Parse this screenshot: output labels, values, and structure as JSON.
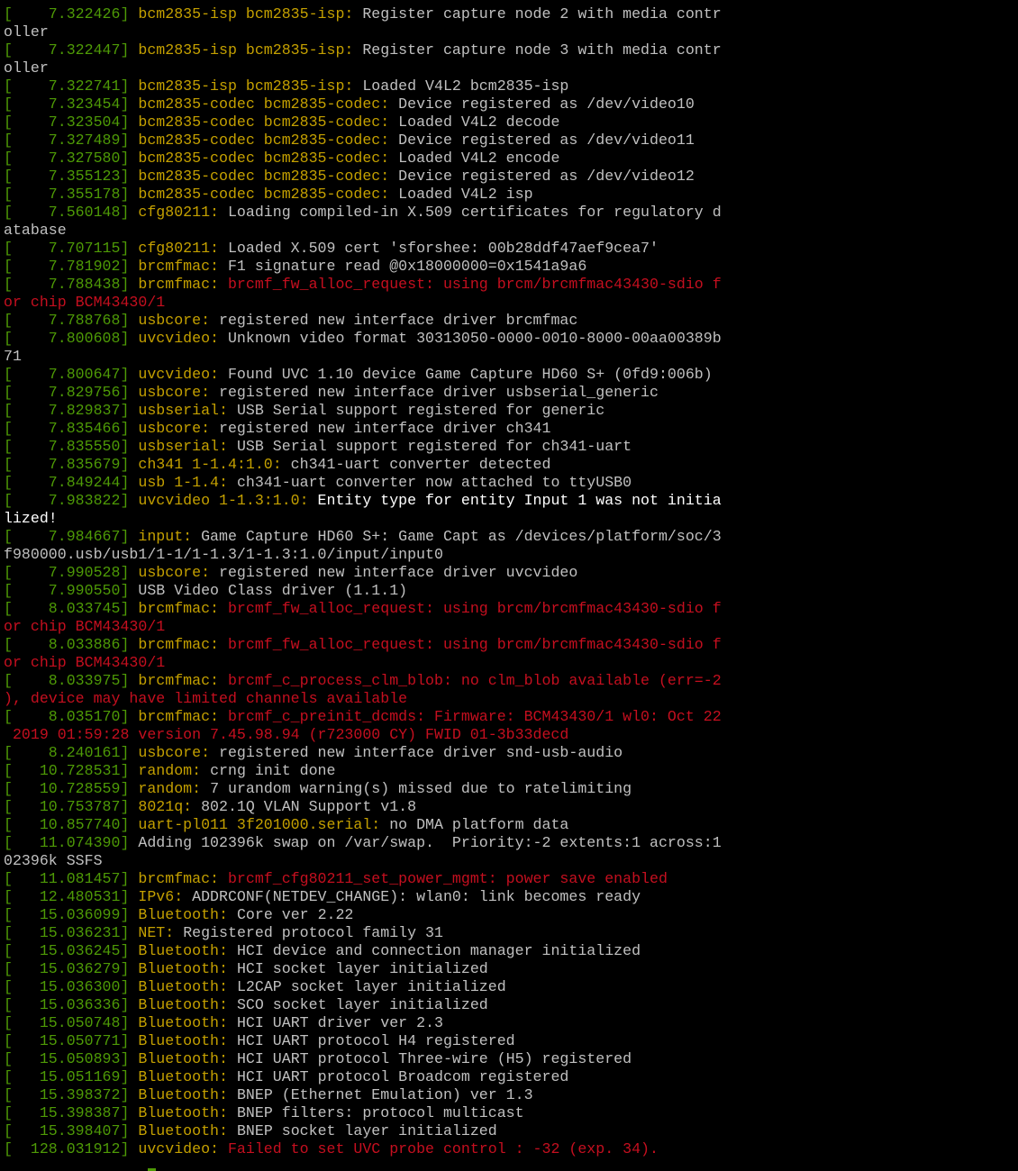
{
  "terminal": {
    "colors": {
      "background": "#000000",
      "text": "#c0c0c0",
      "bracket_timestamp": "#4e9a06",
      "module": "#c4a000",
      "error": "#c50f1f",
      "bold": "#ffffff"
    },
    "lines": [
      {
        "text": "oller",
        "style": "plain"
      },
      {
        "ts": "[    7.322426]",
        "mod": "bcm2835-isp bcm2835-isp:",
        "msg": " Register capture node 2 with media contr",
        "style": "normal"
      },
      {
        "text": "oller",
        "style": "plain"
      },
      {
        "ts": "[    7.322447]",
        "mod": "bcm2835-isp bcm2835-isp:",
        "msg": " Register capture node 3 with media contr",
        "style": "normal"
      },
      {
        "text": "oller",
        "style": "plain"
      },
      {
        "ts": "[    7.322741]",
        "mod": "bcm2835-isp bcm2835-isp:",
        "msg": " Loaded V4L2 bcm2835-isp",
        "style": "normal"
      },
      {
        "ts": "[    7.323454]",
        "mod": "bcm2835-codec bcm2835-codec:",
        "msg": " Device registered as /dev/video10",
        "style": "normal"
      },
      {
        "ts": "[    7.323504]",
        "mod": "bcm2835-codec bcm2835-codec:",
        "msg": " Loaded V4L2 decode",
        "style": "normal"
      },
      {
        "ts": "[    7.327489]",
        "mod": "bcm2835-codec bcm2835-codec:",
        "msg": " Device registered as /dev/video11",
        "style": "normal"
      },
      {
        "ts": "[    7.327580]",
        "mod": "bcm2835-codec bcm2835-codec:",
        "msg": " Loaded V4L2 encode",
        "style": "normal"
      },
      {
        "ts": "[    7.355123]",
        "mod": "bcm2835-codec bcm2835-codec:",
        "msg": " Device registered as /dev/video12",
        "style": "normal"
      },
      {
        "ts": "[    7.355178]",
        "mod": "bcm2835-codec bcm2835-codec:",
        "msg": " Loaded V4L2 isp",
        "style": "normal"
      },
      {
        "ts": "[    7.560148]",
        "mod": "cfg80211:",
        "msg": " Loading compiled-in X.509 certificates for regulatory d",
        "style": "normal"
      },
      {
        "text": "atabase",
        "style": "plain"
      },
      {
        "ts": "[    7.707115]",
        "mod": "cfg80211:",
        "msg": " Loaded X.509 cert 'sforshee: 00b28ddf47aef9cea7'",
        "style": "normal"
      },
      {
        "ts": "[    7.781902]",
        "mod": "brcmfmac:",
        "msg": " F1 signature read @0x18000000=0x1541a9a6",
        "style": "normal"
      },
      {
        "ts": "[    7.788438]",
        "mod": "brcmfmac:",
        "msg": " brcmf_fw_alloc_request: using brcm/brcmfmac43430-sdio f",
        "style": "error"
      },
      {
        "text": "or chip BCM43430/1",
        "style": "plain-error"
      },
      {
        "ts": "[    7.788768]",
        "mod": "usbcore:",
        "msg": " registered new interface driver brcmfmac",
        "style": "normal"
      },
      {
        "ts": "[    7.800608]",
        "mod": "uvcvideo:",
        "msg": " Unknown video format 30313050-0000-0010-8000-00aa00389b",
        "style": "normal"
      },
      {
        "text": "71",
        "style": "plain"
      },
      {
        "ts": "[    7.800647]",
        "mod": "uvcvideo:",
        "msg": " Found UVC 1.10 device Game Capture HD60 S+ (0fd9:006b)",
        "style": "normal"
      },
      {
        "ts": "[    7.829756]",
        "mod": "usbcore:",
        "msg": " registered new interface driver usbserial_generic",
        "style": "normal"
      },
      {
        "ts": "[    7.829837]",
        "mod": "usbserial:",
        "msg": " USB Serial support registered for generic",
        "style": "normal"
      },
      {
        "ts": "[    7.835466]",
        "mod": "usbcore:",
        "msg": " registered new interface driver ch341",
        "style": "normal"
      },
      {
        "ts": "[    7.835550]",
        "mod": "usbserial:",
        "msg": " USB Serial support registered for ch341-uart",
        "style": "normal"
      },
      {
        "ts": "[    7.835679]",
        "mod": "ch341 1-1.4:1.0:",
        "msg": " ch341-uart converter detected",
        "style": "normal"
      },
      {
        "ts": "[    7.849244]",
        "mod": "usb 1-1.4:",
        "msg": " ch341-uart converter now attached to ttyUSB0",
        "style": "normal"
      },
      {
        "ts": "[    7.983822]",
        "mod": "uvcvideo 1-1.3:1.0:",
        "msg": " Entity type for entity Input 1 was not initia",
        "style": "bold"
      },
      {
        "text": "lized!",
        "style": "plain-bold"
      },
      {
        "ts": "[    7.984667]",
        "mod": "input:",
        "msg": " Game Capture HD60 S+: Game Capt as /devices/platform/soc/3",
        "style": "normal"
      },
      {
        "text": "f980000.usb/usb1/1-1/1-1.3/1-1.3:1.0/input/input0",
        "style": "plain"
      },
      {
        "ts": "[    7.990528]",
        "mod": "usbcore:",
        "msg": " registered new interface driver uvcvideo",
        "style": "normal"
      },
      {
        "ts": "[    7.990550]",
        "mod": "",
        "msg": "USB Video Class driver (1.1.1)",
        "style": "normal"
      },
      {
        "ts": "[    8.033745]",
        "mod": "brcmfmac:",
        "msg": " brcmf_fw_alloc_request: using brcm/brcmfmac43430-sdio f",
        "style": "error"
      },
      {
        "text": "or chip BCM43430/1",
        "style": "plain-error"
      },
      {
        "ts": "[    8.033886]",
        "mod": "brcmfmac:",
        "msg": " brcmf_fw_alloc_request: using brcm/brcmfmac43430-sdio f",
        "style": "error"
      },
      {
        "text": "or chip BCM43430/1",
        "style": "plain-error"
      },
      {
        "ts": "[    8.033975]",
        "mod": "brcmfmac:",
        "msg": " brcmf_c_process_clm_blob: no clm_blob available (err=-2",
        "style": "error"
      },
      {
        "text": "), device may have limited channels available",
        "style": "plain-error"
      },
      {
        "ts": "[    8.035170]",
        "mod": "brcmfmac:",
        "msg": " brcmf_c_preinit_dcmds: Firmware: BCM43430/1 wl0: Oct 22",
        "style": "error"
      },
      {
        "text": " 2019 01:59:28 version 7.45.98.94 (r723000 CY) FWID 01-3b33decd",
        "style": "plain-error"
      },
      {
        "ts": "[    8.240161]",
        "mod": "usbcore:",
        "msg": " registered new interface driver snd-usb-audio",
        "style": "normal"
      },
      {
        "ts": "[   10.728531]",
        "mod": "random:",
        "msg": " crng init done",
        "style": "normal"
      },
      {
        "ts": "[   10.728559]",
        "mod": "random:",
        "msg": " 7 urandom warning(s) missed due to ratelimiting",
        "style": "normal"
      },
      {
        "ts": "[   10.753787]",
        "mod": "8021q:",
        "msg": " 802.1Q VLAN Support v1.8",
        "style": "normal"
      },
      {
        "ts": "[   10.857740]",
        "mod": "uart-pl011 3f201000.serial:",
        "msg": " no DMA platform data",
        "style": "normal"
      },
      {
        "ts": "[   11.074390]",
        "mod": "",
        "msg": "Adding 102396k swap on /var/swap.  Priority:-2 extents:1 across:1",
        "style": "normal"
      },
      {
        "text": "02396k SSFS",
        "style": "plain"
      },
      {
        "ts": "[   11.081457]",
        "mod": "brcmfmac:",
        "msg": " brcmf_cfg80211_set_power_mgmt: power save enabled",
        "style": "error"
      },
      {
        "ts": "[   12.480531]",
        "mod": "IPv6:",
        "msg": " ADDRCONF(NETDEV_CHANGE): wlan0: link becomes ready",
        "style": "normal"
      },
      {
        "ts": "[   15.036099]",
        "mod": "Bluetooth:",
        "msg": " Core ver 2.22",
        "style": "normal"
      },
      {
        "ts": "[   15.036231]",
        "mod": "NET:",
        "msg": " Registered protocol family 31",
        "style": "normal"
      },
      {
        "ts": "[   15.036245]",
        "mod": "Bluetooth:",
        "msg": " HCI device and connection manager initialized",
        "style": "normal"
      },
      {
        "ts": "[   15.036279]",
        "mod": "Bluetooth:",
        "msg": " HCI socket layer initialized",
        "style": "normal"
      },
      {
        "ts": "[   15.036300]",
        "mod": "Bluetooth:",
        "msg": " L2CAP socket layer initialized",
        "style": "normal"
      },
      {
        "ts": "[   15.036336]",
        "mod": "Bluetooth:",
        "msg": " SCO socket layer initialized",
        "style": "normal"
      },
      {
        "ts": "[   15.050748]",
        "mod": "Bluetooth:",
        "msg": " HCI UART driver ver 2.3",
        "style": "normal"
      },
      {
        "ts": "[   15.050771]",
        "mod": "Bluetooth:",
        "msg": " HCI UART protocol H4 registered",
        "style": "normal"
      },
      {
        "ts": "[   15.050893]",
        "mod": "Bluetooth:",
        "msg": " HCI UART protocol Three-wire (H5) registered",
        "style": "normal"
      },
      {
        "ts": "[   15.051169]",
        "mod": "Bluetooth:",
        "msg": " HCI UART protocol Broadcom registered",
        "style": "normal"
      },
      {
        "ts": "[   15.398372]",
        "mod": "Bluetooth:",
        "msg": " BNEP (Ethernet Emulation) ver 1.3",
        "style": "normal"
      },
      {
        "ts": "[   15.398387]",
        "mod": "Bluetooth:",
        "msg": " BNEP filters: protocol multicast",
        "style": "normal"
      },
      {
        "ts": "[   15.398407]",
        "mod": "Bluetooth:",
        "msg": " BNEP socket layer initialized",
        "style": "normal"
      },
      {
        "ts": "[  128.031912]",
        "mod": "uvcvideo:",
        "msg": " Failed to set UVC probe control : -32 (exp. 34).",
        "style": "error"
      }
    ]
  }
}
